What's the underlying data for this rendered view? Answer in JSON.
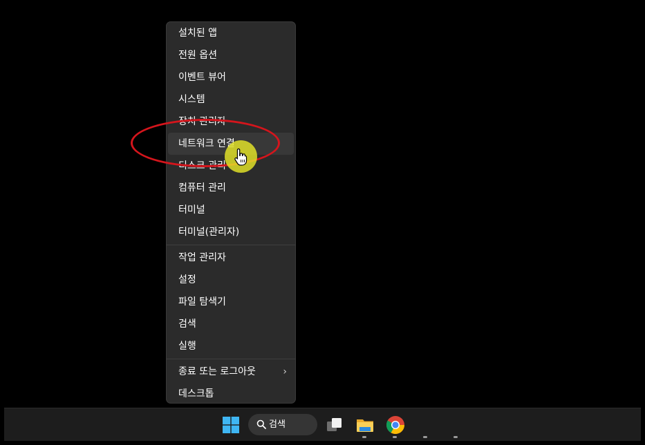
{
  "context_menu": {
    "group1": [
      {
        "label": "설치된 앱"
      },
      {
        "label": "전원 옵션"
      },
      {
        "label": "이벤트 뷰어"
      },
      {
        "label": "시스템"
      },
      {
        "label": "장치 관리자"
      },
      {
        "label": "네트워크 연결",
        "hovered": true
      },
      {
        "label": "디스크 관리"
      },
      {
        "label": "컴퓨터 관리"
      },
      {
        "label": "터미널"
      },
      {
        "label": "터미널(관리자)"
      }
    ],
    "group2": [
      {
        "label": "작업 관리자"
      },
      {
        "label": "설정"
      },
      {
        "label": "파일 탐색기"
      },
      {
        "label": "검색"
      },
      {
        "label": "실행"
      }
    ],
    "group3": [
      {
        "label": "종료 또는 로그아웃",
        "submenu_icon": "chevron-right-icon",
        "submenu_glyph": "›"
      },
      {
        "label": "데스크톱"
      }
    ]
  },
  "annotation": {
    "highlight_color": "#d4151c",
    "cursor_halo_color": "#e6e628"
  },
  "taskbar": {
    "search_label": "검색",
    "icons": [
      "windows-start-icon",
      "search-icon",
      "task-view-icon",
      "file-explorer-icon",
      "chrome-icon"
    ]
  }
}
